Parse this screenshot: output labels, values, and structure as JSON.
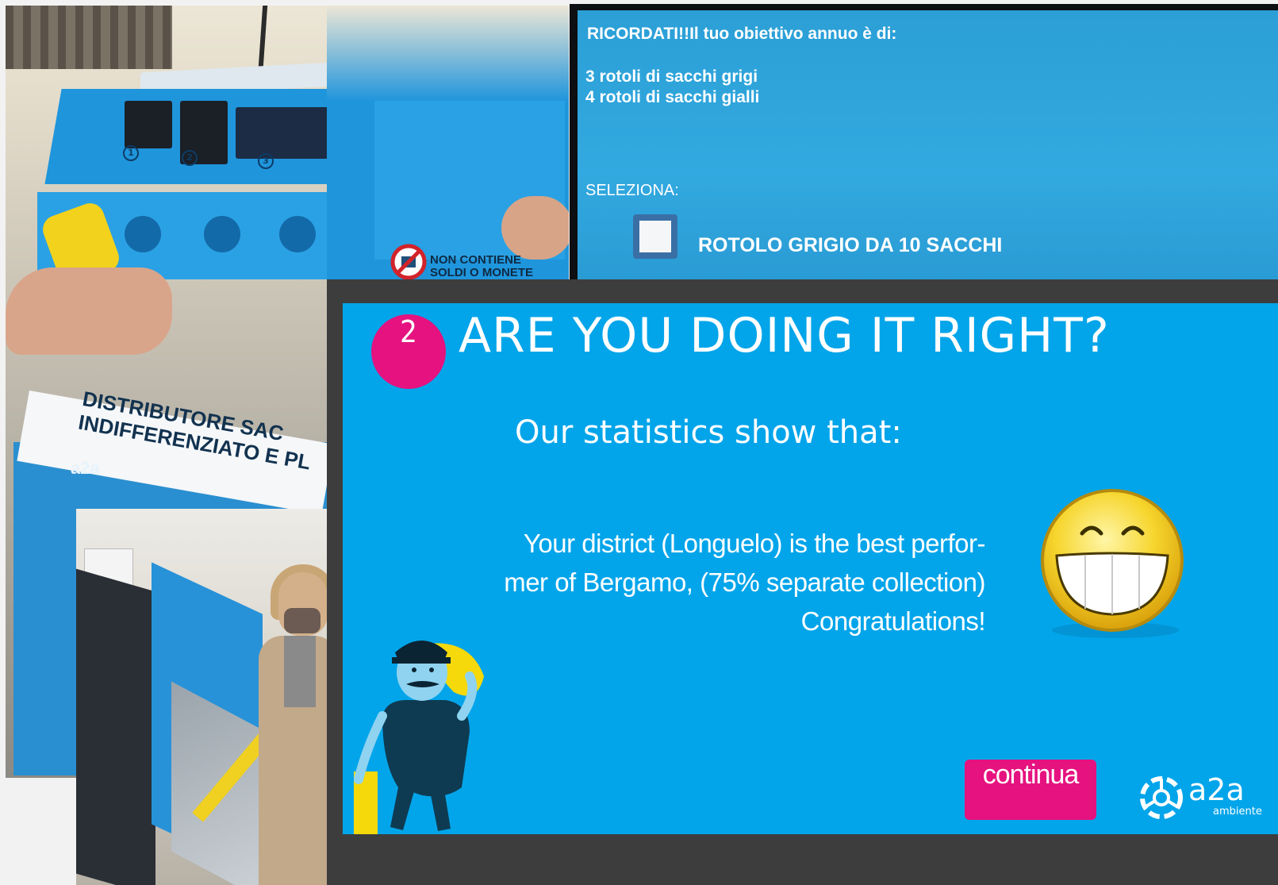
{
  "machine_photo": {
    "label_lines": [
      "DISTRIBUTORE SAC",
      "INDIFFERENZIATO E PL"
    ],
    "logo": "a2a",
    "logo_sub": "ambiente",
    "step_numbers": [
      "1",
      "2",
      "3"
    ],
    "notice_lines": [
      "NON CONTIENE",
      "SOLDI O MONETE"
    ]
  },
  "screen_photo": {
    "reminder": "RICORDATI!!Il tuo obiettivo annuo è di:",
    "goal_grey": "3 rotoli di sacchi grigi",
    "goal_yellow": "4 rotoli di sacchi gialli",
    "select_label": "SELEZIONA:",
    "option_label": "ROTOLO GRIGIO DA 10 SACCHI"
  },
  "slide": {
    "step_number": "2",
    "title": "ARE YOU DOING IT RIGHT?",
    "subtitle": "Our statistics show that:",
    "message_line1": "Your district (Longuelo) is the best perfor-",
    "message_line2": "mer of Bergamo, (75% separate collection)",
    "message_line3": "Congratulations!",
    "continue_label": "continua",
    "brand_name": "a2a",
    "brand_sub": "ambiente",
    "icons": [
      "grinning-smiley-icon",
      "mascot-illustration",
      "a2a-logo-icon"
    ]
  },
  "colors": {
    "slide_bg": "#03a5ea",
    "accent": "#e5127f",
    "frame": "#3d3d3d"
  }
}
